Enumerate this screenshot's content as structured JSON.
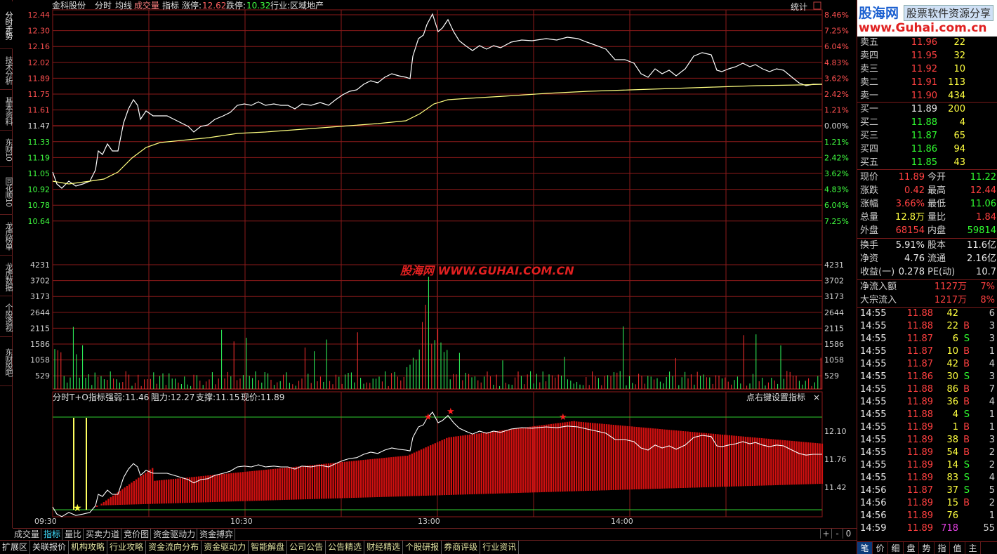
{
  "header": {
    "name": "金科股份",
    "items": [
      "分时",
      "均线",
      "成交量",
      "指标"
    ],
    "limit_up_label": "涨停:",
    "limit_up": "12.62",
    "limit_down_label": "跌停:",
    "limit_down": "10.32",
    "industry": "行业:区域地产",
    "stats": "统计"
  },
  "left_tabs": [
    "分时走势",
    "技术分析",
    "基本资料",
    "东财10",
    "同花顺10",
    "龙虎榜单",
    "龙虎数据",
    "个股透视",
    "东财股吧"
  ],
  "price_axis_left": [
    "12.44",
    "12.30",
    "12.16",
    "12.02",
    "11.89",
    "11.75",
    "11.61",
    "11.47",
    "11.33",
    "11.19",
    "11.05",
    "10.92",
    "10.78",
    "10.64"
  ],
  "price_axis_right": [
    "8.46%",
    "7.25%",
    "6.04%",
    "4.83%",
    "3.62%",
    "2.42%",
    "1.21%",
    "0.00%",
    "1.21%",
    "2.42%",
    "3.62%",
    "4.83%",
    "6.04%",
    "7.25%"
  ],
  "volume_axis": [
    "4231",
    "3702",
    "3173",
    "2644",
    "2115",
    "1586",
    "1058",
    "529"
  ],
  "indicator": {
    "title": "分时T+O指标",
    "strong": "强弱:11.46",
    "resist": "阻力:12.27",
    "support": "支撑:11.15",
    "price": "现价:11.89",
    "hint": "点右键设置指标",
    "close": "×",
    "axis": [
      "12.10",
      "11.76",
      "11.42"
    ]
  },
  "time_axis": [
    "09:30",
    "10:30",
    "13:00",
    "14:00"
  ],
  "watermark": "股海网 WWW.GUHAI.COM.CN",
  "logo": {
    "line1": "股海网",
    "line1b": "股票软件资源分享",
    "line2": "www.Guhai.com.cn"
  },
  "sell_orders": [
    {
      "label": "卖五",
      "price": "11.96",
      "vol": "22"
    },
    {
      "label": "卖四",
      "price": "11.95",
      "vol": "32"
    },
    {
      "label": "卖三",
      "price": "11.92",
      "vol": "10"
    },
    {
      "label": "卖二",
      "price": "11.91",
      "vol": "113"
    },
    {
      "label": "卖一",
      "price": "11.90",
      "vol": "434"
    }
  ],
  "buy_orders": [
    {
      "label": "买一",
      "price": "11.89",
      "vol": "200"
    },
    {
      "label": "买二",
      "price": "11.88",
      "vol": "4"
    },
    {
      "label": "买三",
      "price": "11.87",
      "vol": "65"
    },
    {
      "label": "买四",
      "price": "11.86",
      "vol": "94"
    },
    {
      "label": "买五",
      "price": "11.85",
      "vol": "43"
    }
  ],
  "quote": [
    {
      "l1": "现价",
      "v1": "11.89",
      "c1": "red",
      "l2": "今开",
      "v2": "11.22",
      "c2": "green"
    },
    {
      "l1": "涨跌",
      "v1": "0.42",
      "c1": "red",
      "l2": "最高",
      "v2": "12.44",
      "c2": "red"
    },
    {
      "l1": "涨幅",
      "v1": "3.66%",
      "c1": "red",
      "l2": "最低",
      "v2": "11.06",
      "c2": "green"
    },
    {
      "l1": "总量",
      "v1": "12.8万",
      "c1": "yellow",
      "l2": "量比",
      "v2": "1.84",
      "c2": "red"
    },
    {
      "l1": "外盘",
      "v1": "68154",
      "c1": "red",
      "l2": "内盘",
      "v2": "59814",
      "c2": "green"
    }
  ],
  "fund": [
    {
      "l1": "换手",
      "v1": "5.91%",
      "l2": "股本",
      "v2": "11.6亿"
    },
    {
      "l1": "净资",
      "v1": "4.76",
      "l2": "流通",
      "v2": "2.16亿"
    },
    {
      "l1": "收益(一)",
      "v1": "0.278",
      "l2": "PE(动)",
      "v2": "10.7"
    }
  ],
  "flow": [
    {
      "label": "净流入额",
      "value": "1127万",
      "pct": "7%"
    },
    {
      "label": "大宗流入",
      "value": "1217万",
      "pct": "8%"
    }
  ],
  "ticks": [
    {
      "t": "14:55",
      "p": "11.88",
      "v": "42",
      "bs": "",
      "n": "6"
    },
    {
      "t": "14:55",
      "p": "11.88",
      "v": "22",
      "bs": "B",
      "n": "3"
    },
    {
      "t": "14:55",
      "p": "11.87",
      "v": "6",
      "bs": "S",
      "n": "3"
    },
    {
      "t": "14:55",
      "p": "11.87",
      "v": "10",
      "bs": "B",
      "n": "1"
    },
    {
      "t": "14:55",
      "p": "11.87",
      "v": "42",
      "bs": "B",
      "n": "4"
    },
    {
      "t": "14:55",
      "p": "11.86",
      "v": "30",
      "bs": "S",
      "n": "3"
    },
    {
      "t": "14:55",
      "p": "11.88",
      "v": "86",
      "bs": "B",
      "n": "7"
    },
    {
      "t": "14:55",
      "p": "11.89",
      "v": "36",
      "bs": "B",
      "n": "4"
    },
    {
      "t": "14:55",
      "p": "11.88",
      "v": "4",
      "bs": "S",
      "n": "1"
    },
    {
      "t": "14:55",
      "p": "11.89",
      "v": "1",
      "bs": "B",
      "n": "1"
    },
    {
      "t": "14:55",
      "p": "11.89",
      "v": "38",
      "bs": "B",
      "n": "3"
    },
    {
      "t": "14:55",
      "p": "11.89",
      "v": "54",
      "bs": "B",
      "n": "2"
    },
    {
      "t": "14:55",
      "p": "11.89",
      "v": "14",
      "bs": "S",
      "n": "2"
    },
    {
      "t": "14:55",
      "p": "11.89",
      "v": "83",
      "bs": "S",
      "n": "4"
    },
    {
      "t": "14:56",
      "p": "11.87",
      "v": "37",
      "bs": "S",
      "n": "5"
    },
    {
      "t": "14:56",
      "p": "11.89",
      "v": "15",
      "bs": "B",
      "n": "2"
    },
    {
      "t": "14:56",
      "p": "11.89",
      "v": "76",
      "bs": "",
      "n": "1"
    },
    {
      "t": "14:59",
      "p": "11.89",
      "v": "718",
      "bs": "",
      "n": "55"
    }
  ],
  "bottom_tabs": [
    "成交量",
    "指标",
    "量比",
    "买卖力道",
    "竞价图",
    "资金驱动力",
    "资金搏弈"
  ],
  "bottom_right": [
    "+",
    "-",
    "0"
  ],
  "bottom_links": [
    "扩展区",
    "关联报价",
    "机构攻略",
    "行业攻略",
    "资金流向分布",
    "资金驱动力",
    "智能解盘",
    "公司公告",
    "公告精选",
    "财经精选",
    "个股研报",
    "券商评级",
    "行业资讯"
  ],
  "right_bottom_tabs": [
    "笔",
    "价",
    "细",
    "盘",
    "势",
    "指",
    "值",
    "主"
  ],
  "colors": {
    "grid": "#8b1a1a",
    "price_line": "#ffffff",
    "avg_line": "#ffff80",
    "vol_up": "#ff3030",
    "vol_down": "#30ff60",
    "bars": "#d01010"
  }
}
